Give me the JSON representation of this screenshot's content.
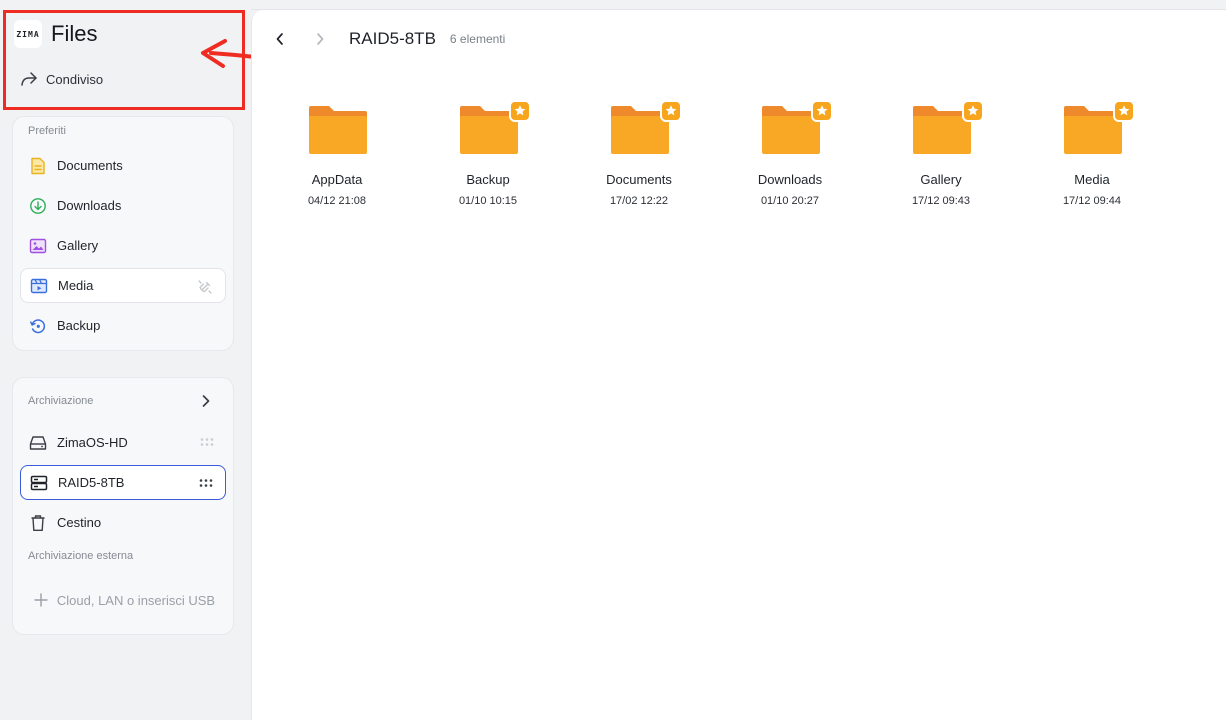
{
  "app": {
    "logo_line1": "ZI",
    "logo_line2": "MA",
    "title": "Files",
    "shared_label": "Condiviso"
  },
  "favorites": {
    "title": "Preferiti",
    "items": [
      {
        "label": "Documents",
        "icon": "document-icon",
        "color": "#e9b21f"
      },
      {
        "label": "Downloads",
        "icon": "download-icon",
        "color": "#2fae5b"
      },
      {
        "label": "Gallery",
        "icon": "gallery-icon",
        "color": "#a050e0"
      },
      {
        "label": "Media",
        "icon": "media-icon",
        "color": "#3b6fe0",
        "trail_icon": "unpin-icon"
      },
      {
        "label": "Backup",
        "icon": "backup-icon",
        "color": "#3b6fe0"
      }
    ]
  },
  "storage": {
    "title": "Archiviazione",
    "items": [
      {
        "label": "ZimaOS-HD",
        "icon": "hard-drive-icon"
      },
      {
        "label": "RAID5-8TB",
        "icon": "raid-icon",
        "selected": true
      },
      {
        "label": "Cestino",
        "icon": "trash-icon"
      }
    ],
    "external_title": "Archiviazione esterna",
    "external_add_label": "Cloud, LAN o inserisci USB"
  },
  "main": {
    "path_title": "RAID5-8TB",
    "item_count": "6 elementi",
    "folders": [
      {
        "name": "AppData",
        "date": "04/12 21:08",
        "starred": false
      },
      {
        "name": "Backup",
        "date": "01/10 10:15",
        "starred": true
      },
      {
        "name": "Documents",
        "date": "17/02 12:22",
        "starred": true
      },
      {
        "name": "Downloads",
        "date": "01/10 20:27",
        "starred": true
      },
      {
        "name": "Gallery",
        "date": "17/12 09:43",
        "starred": true
      },
      {
        "name": "Media",
        "date": "17/12 09:44",
        "starred": true
      }
    ]
  },
  "colors": {
    "folder_body": "#f9a825",
    "folder_tab": "#ee8a2b",
    "star_badge": "#f7a51d",
    "selected_border": "#3b5bdb",
    "annotation": "#ee2c22"
  }
}
